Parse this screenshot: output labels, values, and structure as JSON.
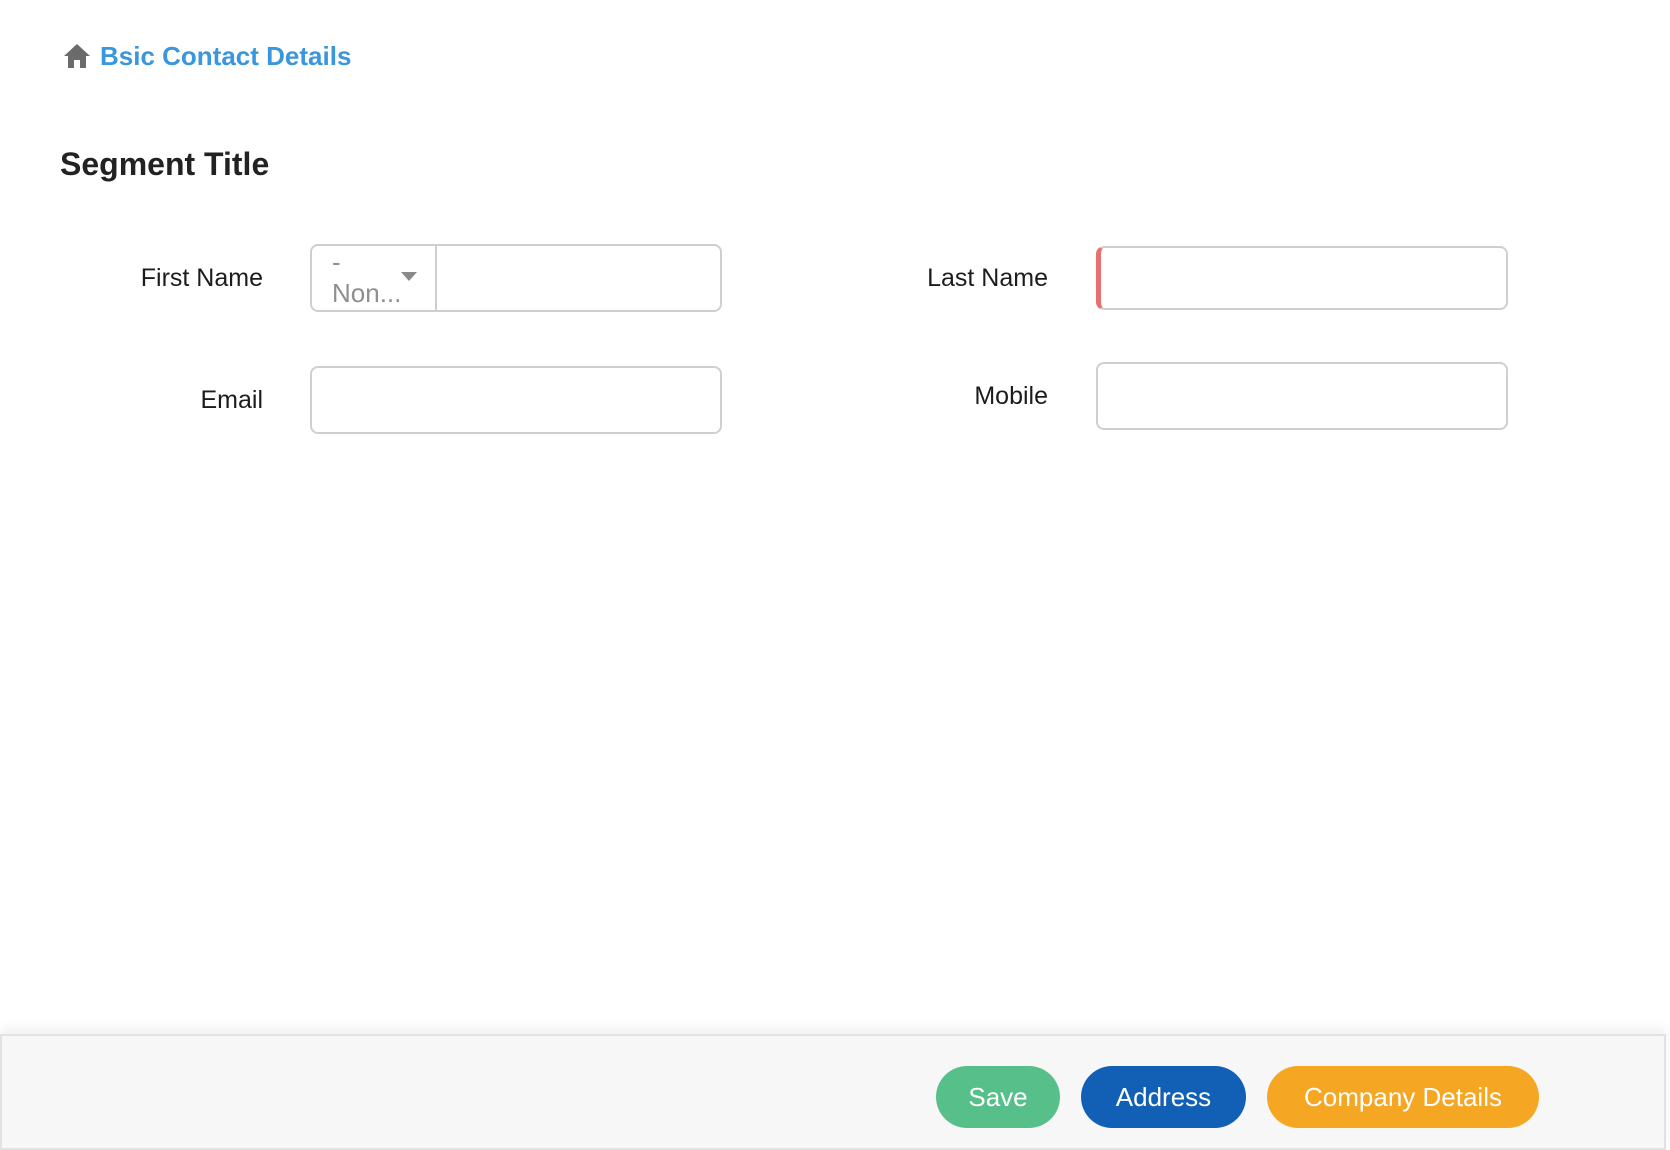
{
  "breadcrumb": {
    "icon": "home-icon",
    "label": "Bsic Contact Details"
  },
  "segment": {
    "title": "Segment Title"
  },
  "form": {
    "first_name": {
      "label": "First Name",
      "salutation_value": "-Non...",
      "value": ""
    },
    "last_name": {
      "label": "Last Name",
      "value": "",
      "required": true
    },
    "email": {
      "label": "Email",
      "value": ""
    },
    "mobile": {
      "label": "Mobile",
      "value": ""
    }
  },
  "footer": {
    "save_label": "Save",
    "address_label": "Address",
    "company_label": "Company Details"
  },
  "colors": {
    "link": "#3a96dd",
    "save": "#57c08a",
    "address": "#1160b6",
    "company": "#f5a623",
    "required_marker": "#e8706f",
    "icon_gray": "#6b6b6b"
  }
}
